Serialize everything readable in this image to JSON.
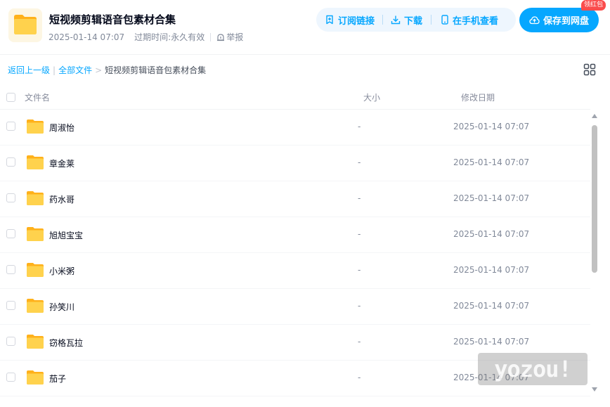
{
  "header": {
    "title": "短视频剪辑语音包素材合集",
    "date": "2025-01-14 07:07",
    "expiry_label": "过期时间:",
    "expiry_value": "永久有效",
    "report_label": "举报",
    "folder_icon": "folder-icon"
  },
  "actions": {
    "subscribe": "订阅链接",
    "download": "下载",
    "mobile_view": "在手机查看",
    "save": "保存到网盘",
    "red_packet": "领红包"
  },
  "breadcrumb": {
    "back": "返回上一级",
    "all_files": "全部文件",
    "separator_bar": "|",
    "separator_arrow": ">",
    "current": "短视频剪辑语音包素材合集"
  },
  "table": {
    "columns": {
      "name": "文件名",
      "size": "大小",
      "date": "修改日期"
    },
    "rows": [
      {
        "name": "周淑怡",
        "size": "-",
        "date": "2025-01-14 07:07"
      },
      {
        "name": "章金莱",
        "size": "-",
        "date": "2025-01-14 07:07"
      },
      {
        "name": "药水哥",
        "size": "-",
        "date": "2025-01-14 07:07"
      },
      {
        "name": "旭旭宝宝",
        "size": "-",
        "date": "2025-01-14 07:07"
      },
      {
        "name": "小米粥",
        "size": "-",
        "date": "2025-01-14 07:07"
      },
      {
        "name": "孙笑川",
        "size": "-",
        "date": "2025-01-14 07:07"
      },
      {
        "name": "窃格瓦拉",
        "size": "-",
        "date": "2025-01-14 07:07"
      },
      {
        "name": "茄子",
        "size": "-",
        "date": "2025-01-14 07:07"
      }
    ]
  },
  "watermark": "yozou!",
  "colors": {
    "accent": "#06a7ff",
    "accent_bg": "#eef6fe",
    "folder_yellow": "#ffc53d",
    "badge_red": "#fa4d4d"
  }
}
